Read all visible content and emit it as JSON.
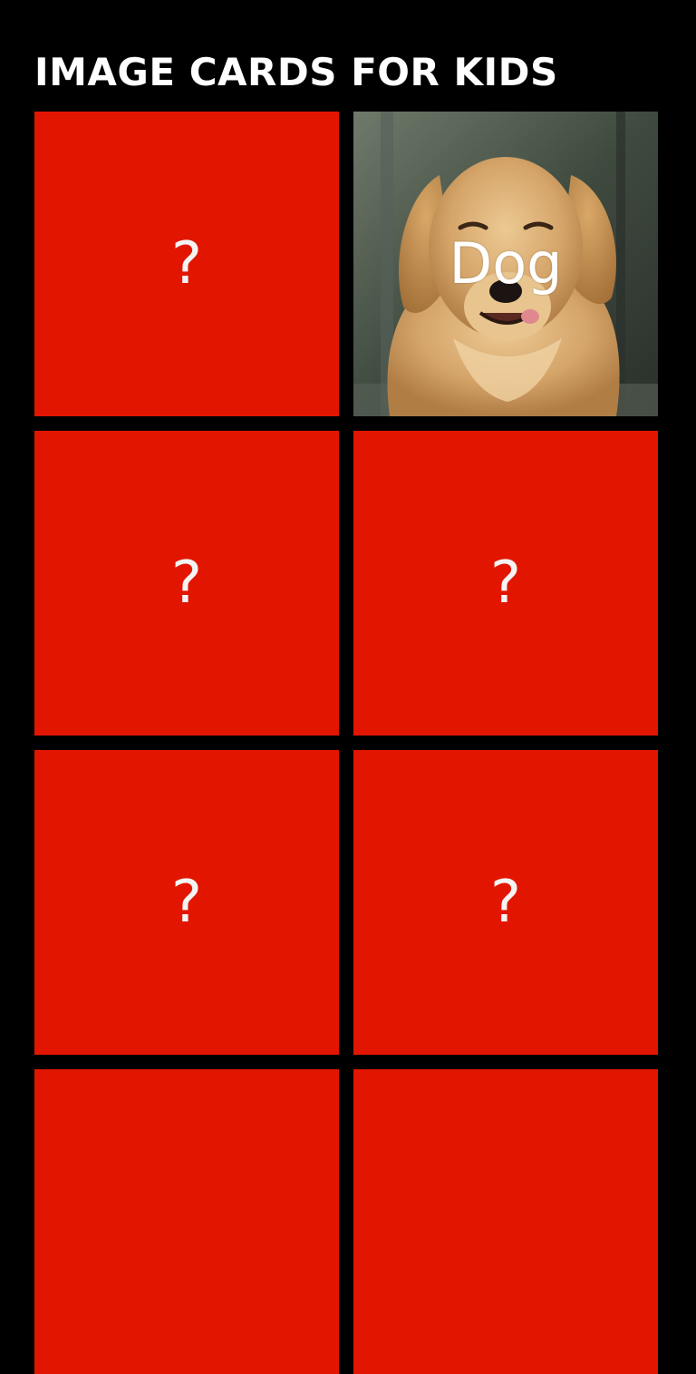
{
  "header": {
    "title": "IMAGE CARDS FOR KIDS"
  },
  "colors": {
    "background": "#000000",
    "card_red": "#e21600",
    "text": "#ffffff"
  },
  "cards": [
    {
      "state": "hidden",
      "label": "?"
    },
    {
      "state": "revealed",
      "label": "Dog",
      "image": "golden-retriever-photo"
    },
    {
      "state": "hidden",
      "label": "?"
    },
    {
      "state": "hidden",
      "label": "?"
    },
    {
      "state": "hidden",
      "label": "?"
    },
    {
      "state": "hidden",
      "label": "?"
    },
    {
      "state": "hidden",
      "label": ""
    },
    {
      "state": "hidden",
      "label": ""
    }
  ]
}
